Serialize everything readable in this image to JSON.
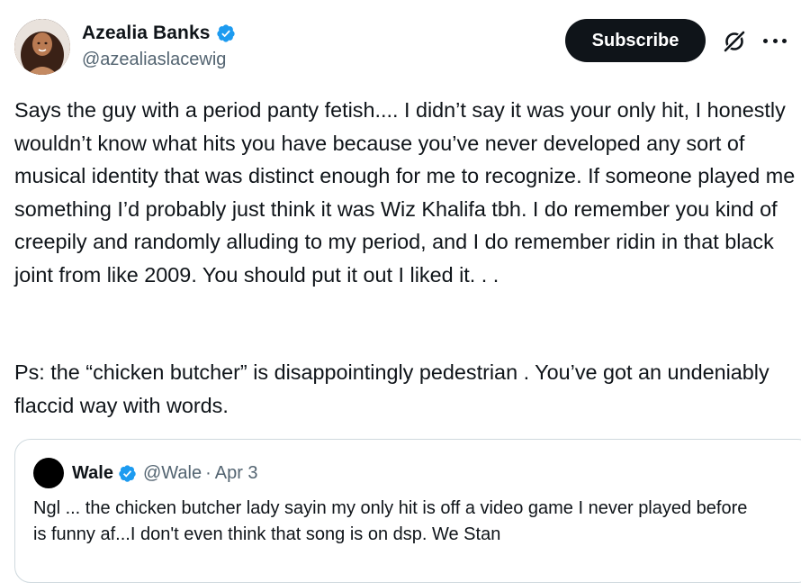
{
  "author": {
    "name": "Azealia Banks",
    "handle": "@azealiaslacewig",
    "verified": true
  },
  "actions": {
    "subscribe_label": "Subscribe",
    "grok_icon": "grok-icon",
    "more_icon": "more-icon"
  },
  "tweet": {
    "body": "Says the guy with a period panty fetish.... I didn’t say it was your only hit, I honestly wouldn’t know what hits you have because you’ve never developed any sort of musical identity that was distinct enough for me to recognize. If someone played me something I’d probably just think it was Wiz Khalifa tbh. I do remember you kind of creepily and randomly alluding to my period, and I do remember ridin in that black joint from like 2009. You should put it out I liked it. . .",
    "ps": "Ps: the “chicken butcher” is disappointingly pedestrian . You’ve got an undeniably flaccid way with words."
  },
  "quote": {
    "name": "Wale",
    "handle": "@Wale",
    "separator": "·",
    "date": "Apr 3",
    "verified": true,
    "text": "Ngl ... the chicken butcher lady  sayin my only hit is off a video game I never played before is funny af...I don't even think that song is on dsp. We Stan"
  },
  "colors": {
    "verified_blue": "#1d9bf0",
    "text_primary": "#0f1419",
    "text_secondary": "#536471",
    "border": "#cfd9de"
  }
}
